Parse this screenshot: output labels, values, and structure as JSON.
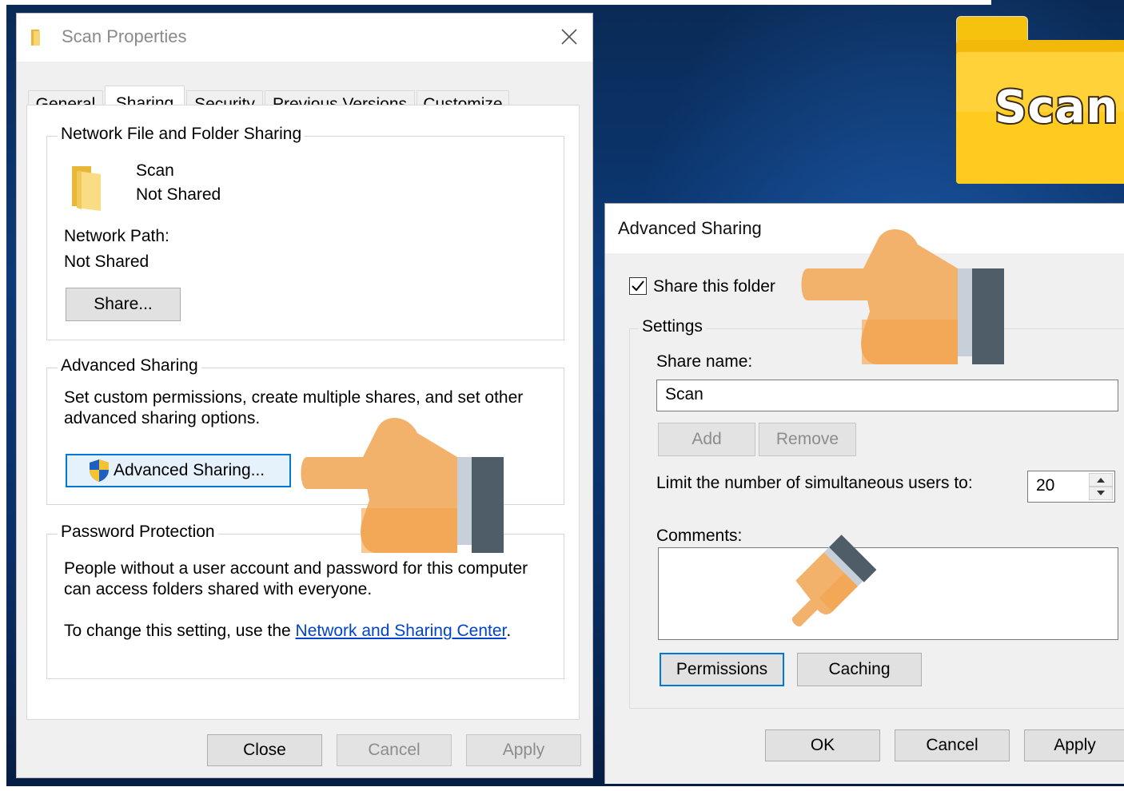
{
  "logo": {
    "text": "Scan"
  },
  "props": {
    "title": "Scan Properties",
    "tabs": [
      "General",
      "Sharing",
      "Security",
      "Previous Versions",
      "Customize"
    ],
    "net_group": {
      "label": "Network File and Folder Sharing",
      "folder_name": "Scan",
      "folder_status": "Not Shared",
      "path_label": "Network Path:",
      "path_value": "Not Shared",
      "share_button": "Share..."
    },
    "adv_group": {
      "label": "Advanced Sharing",
      "desc_line1": "Set custom permissions, create multiple shares, and set other",
      "desc_line2": "advanced sharing options.",
      "button": "Advanced Sharing..."
    },
    "pwd_group": {
      "label": "Password Protection",
      "line1": "People without a user account and password for this computer",
      "line2": "can access folders shared with everyone.",
      "change_prefix": "To change this setting, use the ",
      "link": "Network and Sharing Center",
      "change_suffix": "."
    },
    "buttons": {
      "close": "Close",
      "cancel": "Cancel",
      "apply": "Apply"
    }
  },
  "adv": {
    "title": "Advanced Sharing",
    "share_checkbox": "Share this folder",
    "share_checked": true,
    "settings_label": "Settings",
    "share_name_label": "Share name:",
    "share_name_value": "Scan",
    "add": "Add",
    "remove": "Remove",
    "limit_label": "Limit the number of simultaneous users to:",
    "limit_value": "20",
    "comments_label": "Comments:",
    "permissions": "Permissions",
    "caching": "Caching",
    "ok": "OK",
    "cancel": "Cancel",
    "apply": "Apply"
  },
  "colors": {
    "accent": "#0078d7",
    "hand_skin": "#f3b26b",
    "hand_cuff": "#4f5d69",
    "folder": "#ffd23a"
  }
}
